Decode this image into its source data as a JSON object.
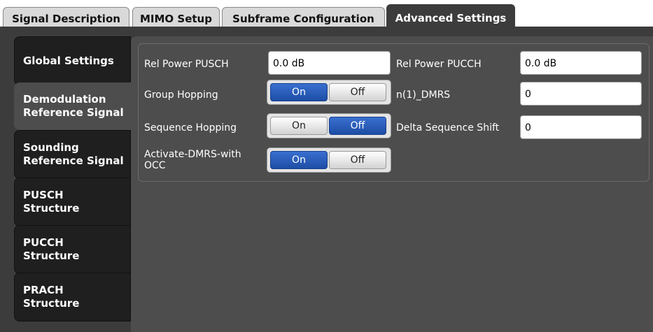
{
  "tabs": [
    {
      "label": "Signal Description",
      "active": false
    },
    {
      "label": "MIMO Setup",
      "active": false
    },
    {
      "label": "Subframe Configuration",
      "active": false
    },
    {
      "label": "Advanced Settings",
      "active": true
    }
  ],
  "sidebar": {
    "items": [
      {
        "label": "Global Settings",
        "active": false
      },
      {
        "label": "Demodulation Reference Signal",
        "line1": "Demodulation",
        "line2": "Reference Signal",
        "active": true
      },
      {
        "label": "Sounding Reference Signal",
        "line1": "Sounding",
        "line2": "Reference Signal",
        "active": false
      },
      {
        "label": "PUSCH Structure",
        "line1": "PUSCH",
        "line2": "Structure",
        "active": false
      },
      {
        "label": "PUCCH Structure",
        "line1": "PUCCH",
        "line2": "Structure",
        "active": false
      },
      {
        "label": "PRACH Structure",
        "line1": "PRACH",
        "line2": "Structure",
        "active": false
      }
    ]
  },
  "settings": {
    "rel_power_pusch": {
      "label": "Rel Power PUSCH",
      "value": "0.0 dB"
    },
    "rel_power_pucch": {
      "label": "Rel Power PUCCH",
      "value": "0.0 dB"
    },
    "group_hopping": {
      "label": "Group Hopping",
      "on": "On",
      "off": "Off",
      "selected": "On"
    },
    "n1_dmrs": {
      "label": "n(1)_DMRS",
      "value": "0"
    },
    "sequence_hopping": {
      "label": "Sequence Hopping",
      "on": "On",
      "off": "Off",
      "selected": "Off"
    },
    "delta_sequence_shift": {
      "label": "Delta Sequence Shift",
      "value": "0"
    },
    "activate_dmrs_with_occ": {
      "label_line1": "Activate-DMRS-with",
      "label_line2": "OCC",
      "on": "On",
      "off": "Off",
      "selected": "On"
    }
  },
  "colors": {
    "selected_blue": "#2a5fc0",
    "panel_dark": "#3c3c3c",
    "panel_mid": "#4d4d4d"
  }
}
